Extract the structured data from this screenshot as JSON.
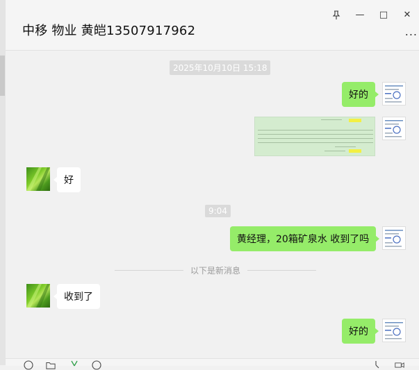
{
  "window": {
    "pin_icon": "pin-icon",
    "minimize_symbol": "—",
    "maximize_symbol": "□",
    "close_symbol": "✕"
  },
  "header": {
    "title": "中移 物业 黄皑13507917962",
    "more_symbol": "..."
  },
  "messages": {
    "timestamp1": "2025年10月10日 15:18",
    "msg1_text": "好的",
    "msg3_text": "好",
    "timestamp2": "9:04",
    "msg4_text": "黄经理，20箱矿泉水 收到了吗",
    "new_messages_divider": "以下是新消息",
    "msg5_text": "收到了",
    "msg6_text": "好的"
  },
  "colors": {
    "my_bubble": "#95ec69",
    "their_bubble": "#ffffff",
    "background": "#f1f1f1"
  }
}
